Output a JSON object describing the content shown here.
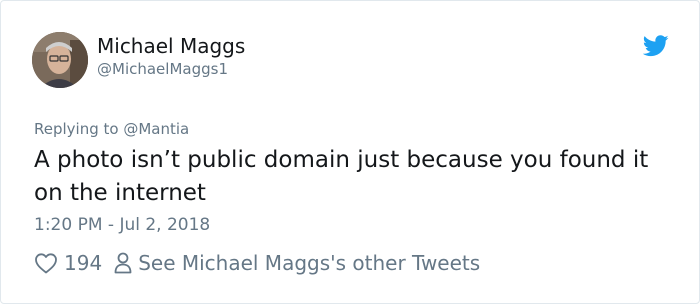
{
  "author": {
    "name": "Michael Maggs",
    "handle": "@MichaelMaggs1",
    "avatar_icon": "user-avatar-photo"
  },
  "reply": {
    "prefix": "Replying to ",
    "mention": "@Mantia"
  },
  "tweet": {
    "text": "A photo isn’t public domain just because you found it on the internet",
    "timestamp": "1:20 PM - Jul 2, 2018"
  },
  "actions": {
    "like_count": "194",
    "like_icon": "heart-icon",
    "profile_link_label": "See Michael Maggs's other Tweets",
    "profile_icon": "person-icon"
  },
  "brand": {
    "logo_icon": "twitter-bird-icon",
    "color": "#1da1f2"
  },
  "colors": {
    "primary_text": "#14171a",
    "secondary_text": "#657786",
    "border": "#e1e8ed"
  }
}
